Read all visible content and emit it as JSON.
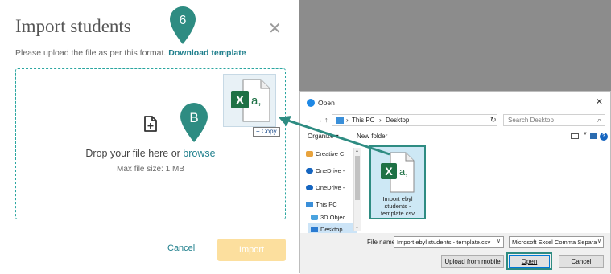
{
  "import_modal": {
    "title": "Import students",
    "instruction": "Please upload the file as per this format.",
    "download_link": "Download template",
    "drop_text": "Drop your file here or",
    "browse_link": "browse",
    "max_size": "Max file size: 1 MB",
    "cancel_label": "Cancel",
    "import_label": "Import",
    "accent_color": "#1f7f8c",
    "import_button_color": "#fcdf9e"
  },
  "drag_ghost": {
    "icon": "excel-file-icon",
    "copy_badge": "+ Copy"
  },
  "annotations": {
    "step_marker": "6",
    "letter_marker": "B",
    "marker_color": "#2e8c82"
  },
  "open_dialog": {
    "title": "Open",
    "breadcrumb": [
      "This PC",
      "Desktop"
    ],
    "search_placeholder": "Search Desktop",
    "organize_label": "Organize ▾",
    "new_folder_label": "New folder",
    "nav_items": [
      {
        "label": "Creative C",
        "icon": "creative-cloud-icon",
        "selected": false
      },
      {
        "label": "OneDrive -",
        "icon": "onedrive-icon",
        "selected": false
      },
      {
        "label": "OneDrive -",
        "icon": "onedrive-icon",
        "selected": false
      },
      {
        "label": "This PC",
        "icon": "pc-icon",
        "selected": false
      },
      {
        "label": "3D Objec",
        "icon": "3d-objects-icon",
        "selected": false
      },
      {
        "label": "Desktop",
        "icon": "desktop-icon",
        "selected": true
      }
    ],
    "file_tile": {
      "name_lines": [
        "Import ebyl",
        "students -",
        "template.csv"
      ],
      "icon": "excel-file-icon"
    },
    "file_name_label": "File name:",
    "file_name_value": "Import ebyl students - template.csv",
    "file_type_value": "Microsoft Excel Comma Separa",
    "upload_mobile_label": "Upload from mobile",
    "open_label": "Open",
    "cancel_label": "Cancel"
  }
}
